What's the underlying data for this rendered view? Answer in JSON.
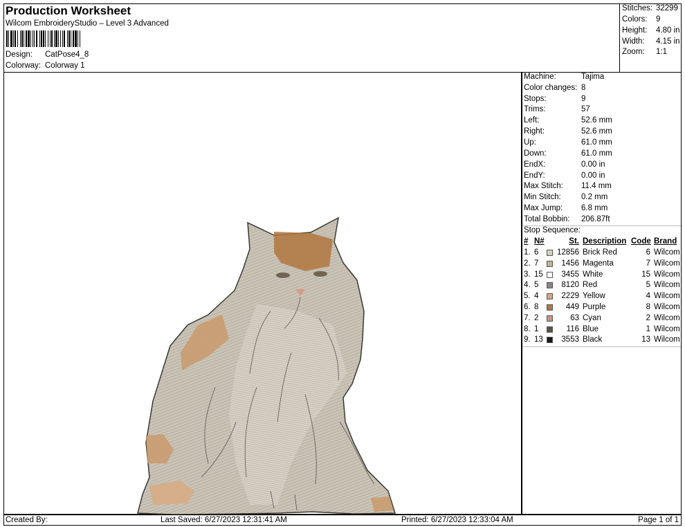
{
  "header": {
    "title": "Production Worksheet",
    "subtitle": "Wilcom EmbroideryStudio – Level 3 Advanced",
    "design_label": "Design:",
    "design_value": "CatPose4_8",
    "colorway_label": "Colorway:",
    "colorway_value": "Colorway 1"
  },
  "stats": [
    {
      "label": "Stitches:",
      "value": "32299"
    },
    {
      "label": "Colors:",
      "value": "9"
    },
    {
      "label": "Height:",
      "value": "4.80 in"
    },
    {
      "label": "Width:",
      "value": "4.15 in"
    },
    {
      "label": "Zoom:",
      "value": "1:1"
    }
  ],
  "info": [
    {
      "label": "Machine:",
      "value": "Tajima"
    },
    {
      "label": "Color changes:",
      "value": "8"
    },
    {
      "label": "Stops:",
      "value": "9"
    },
    {
      "label": "Trims:",
      "value": "57"
    },
    {
      "label": "Left:",
      "value": "52.6 mm"
    },
    {
      "label": "Right:",
      "value": "52.6 mm"
    },
    {
      "label": "Up:",
      "value": "61.0 mm"
    },
    {
      "label": "Down:",
      "value": "61.0 mm"
    },
    {
      "label": "EndX:",
      "value": "0.00 in"
    },
    {
      "label": "EndY:",
      "value": "0.00 in"
    },
    {
      "label": "Max Stitch:",
      "value": "11.4 mm"
    },
    {
      "label": "Min Stitch:",
      "value": "0.2 mm"
    },
    {
      "label": "Max Jump:",
      "value": "6.8 mm"
    },
    {
      "label": "Total Bobbin:",
      "value": "206.87ft"
    }
  ],
  "stop_sequence": {
    "title": "Stop Sequence:",
    "headers": {
      "num": "#",
      "n": "N#",
      "st": "St.",
      "desc": "Description",
      "code": "Code",
      "brand": "Brand"
    },
    "rows": [
      {
        "num": "1.",
        "n": "6",
        "color": "#d9cfc4",
        "st": "12856",
        "desc": "Brick Red",
        "code": "6",
        "brand": "Wilcom"
      },
      {
        "num": "2.",
        "n": "7",
        "color": "#c4b09c",
        "st": "1456",
        "desc": "Magenta",
        "code": "7",
        "brand": "Wilcom"
      },
      {
        "num": "3.",
        "n": "15",
        "color": "#ffffff",
        "st": "3455",
        "desc": "White",
        "code": "15",
        "brand": "Wilcom"
      },
      {
        "num": "4.",
        "n": "5",
        "color": "#8c8680",
        "st": "8120",
        "desc": "Red",
        "code": "5",
        "brand": "Wilcom"
      },
      {
        "num": "5.",
        "n": "4",
        "color": "#cfa88c",
        "st": "2229",
        "desc": "Yellow",
        "code": "4",
        "brand": "Wilcom"
      },
      {
        "num": "6.",
        "n": "8",
        "color": "#b07848",
        "st": "449",
        "desc": "Purple",
        "code": "8",
        "brand": "Wilcom"
      },
      {
        "num": "7.",
        "n": "2",
        "color": "#c89484",
        "st": "63",
        "desc": "Cyan",
        "code": "2",
        "brand": "Wilcom"
      },
      {
        "num": "8.",
        "n": "1",
        "color": "#5a5448",
        "st": "116",
        "desc": "Blue",
        "code": "1",
        "brand": "Wilcom"
      },
      {
        "num": "9.",
        "n": "13",
        "color": "#1a1a1a",
        "st": "3553",
        "desc": "Black",
        "code": "13",
        "brand": "Wilcom"
      }
    ]
  },
  "footer": {
    "created_by": "Created By:",
    "last_saved": "Last Saved: 6/27/2023 12:31:41 AM",
    "printed": "Printed: 6/27/2023 12:33:04 AM",
    "page": "Page 1 of 1"
  },
  "design_preview": {
    "subject": "cat-embroidery-preview"
  }
}
